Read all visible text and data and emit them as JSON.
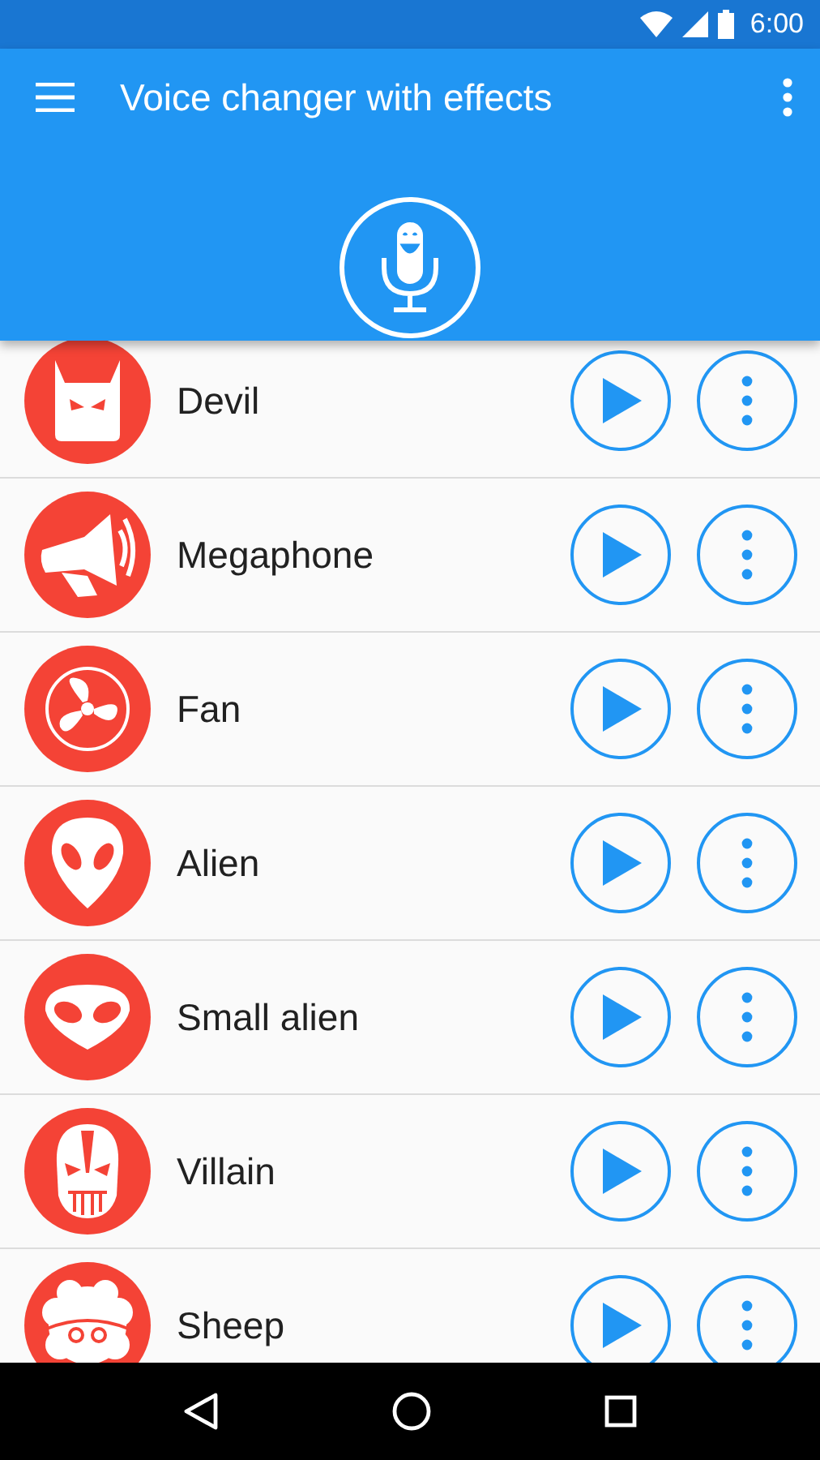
{
  "status_bar": {
    "time": "6:00"
  },
  "app_bar": {
    "title": "Voice changer with effects"
  },
  "effects": [
    {
      "name": "Devil"
    },
    {
      "name": "Megaphone"
    },
    {
      "name": "Fan"
    },
    {
      "name": "Alien"
    },
    {
      "name": "Small alien"
    },
    {
      "name": "Villain"
    },
    {
      "name": "Sheep"
    }
  ]
}
